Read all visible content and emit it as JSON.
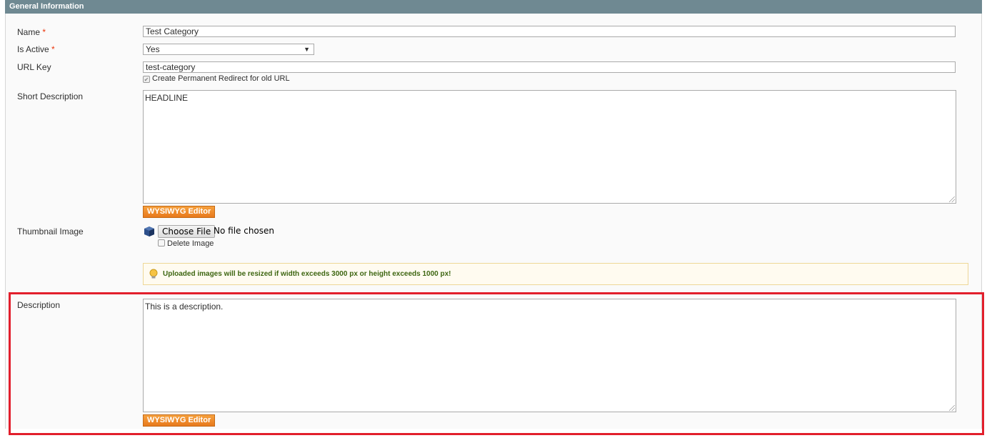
{
  "panel": {
    "title": "General Information"
  },
  "fields": {
    "name": {
      "label": "Name",
      "required_mark": "*",
      "value": "Test Category"
    },
    "is_active": {
      "label": "Is Active",
      "required_mark": "*",
      "value": "Yes"
    },
    "url_key": {
      "label": "URL Key",
      "value": "test-category",
      "redirect_label": "Create Permanent Redirect for old URL"
    },
    "short_description": {
      "label": "Short Description",
      "value": "HEADLINE",
      "wysiwyg_label": "WYSIWYG Editor"
    },
    "thumbnail": {
      "label": "Thumbnail Image",
      "choose_label": "Choose File",
      "status": "No file chosen",
      "delete_label": "Delete Image"
    },
    "notice": "Uploaded images will be resized if width exceeds 3000 px or height exceeds 1000 px!",
    "description": {
      "label": "Description",
      "value": "This is a description.",
      "wysiwyg_label": "WYSIWYG Editor"
    }
  },
  "colors": {
    "header": "#6f8992",
    "button": "#eb7d1f",
    "highlight": "#e21f2c",
    "notice_text": "#3d6611"
  }
}
